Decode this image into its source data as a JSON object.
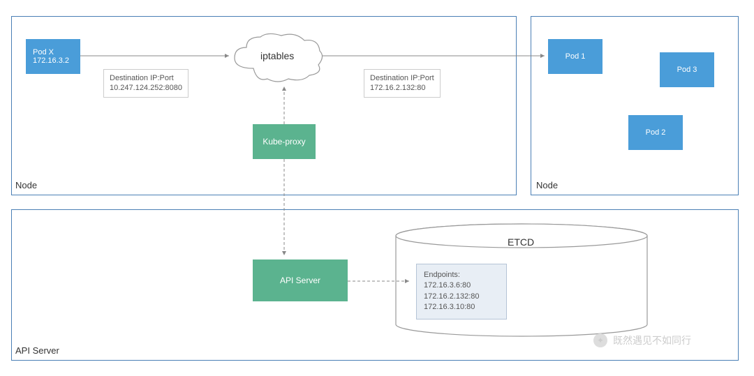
{
  "node_left": {
    "label": "Node"
  },
  "node_right": {
    "label": "Node"
  },
  "api_server_container": {
    "label": "API Server"
  },
  "pod_x": {
    "name": "Pod X",
    "ip": "172.16.3.2"
  },
  "pod_1": {
    "name": "Pod 1"
  },
  "pod_2": {
    "name": "Pod 2"
  },
  "pod_3": {
    "name": "Pod 3"
  },
  "iptables": {
    "label": "iptables"
  },
  "kube_proxy": {
    "label": "Kube-proxy"
  },
  "api_server_box": {
    "label": "API Server"
  },
  "dest1": {
    "title": "Destination IP:Port",
    "value": "10.247.124.252:8080"
  },
  "dest2": {
    "title": "Destination IP:Port",
    "value": "172.16.2.132:80"
  },
  "etcd": {
    "label": "ETCD"
  },
  "endpoints": {
    "title": "Endpoints:",
    "items": [
      "172.16.3.6:80",
      "172.16.2.132:80",
      "172.16.3.10:80"
    ]
  },
  "watermark": {
    "text": "既然遇见不如同行"
  }
}
